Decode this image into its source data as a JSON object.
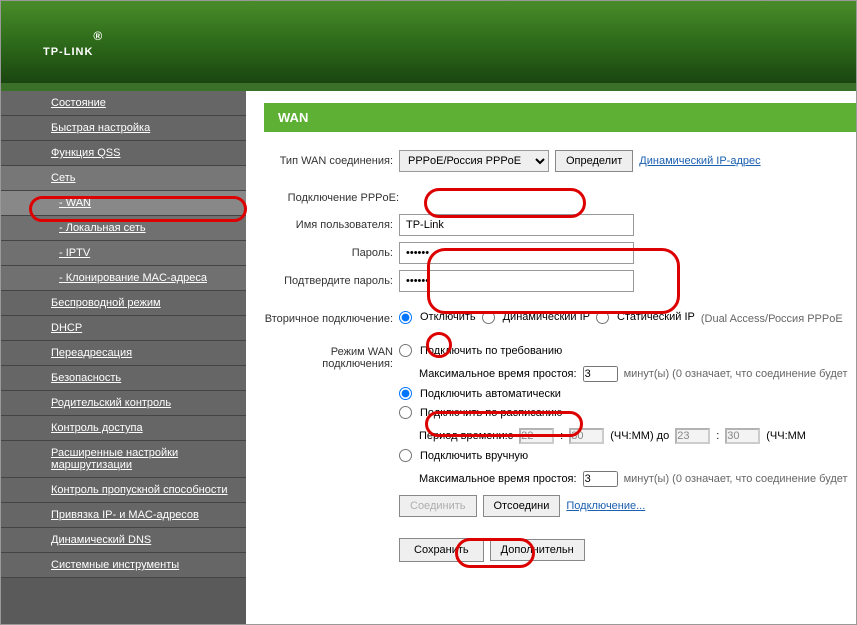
{
  "logo": "TP-LINK",
  "sidebar": {
    "items": [
      {
        "label": "Состояние",
        "sub": false
      },
      {
        "label": "Быстрая настройка",
        "sub": false
      },
      {
        "label": "Функция QSS",
        "sub": false
      },
      {
        "label": "Сеть",
        "sub": false,
        "activeParent": true
      },
      {
        "label": "- WAN",
        "sub": true,
        "active": true
      },
      {
        "label": "- Локальная сеть",
        "sub": true
      },
      {
        "label": "- IPTV",
        "sub": true
      },
      {
        "label": "- Клонирование MAC-адреса",
        "sub": true
      },
      {
        "label": "Беспроводной режим",
        "sub": false
      },
      {
        "label": "DHCP",
        "sub": false
      },
      {
        "label": "Переадресация",
        "sub": false
      },
      {
        "label": "Безопасность",
        "sub": false
      },
      {
        "label": "Родительский контроль",
        "sub": false
      },
      {
        "label": "Контроль доступа",
        "sub": false
      },
      {
        "label": "Расширенные настройки маршрутизации",
        "sub": false
      },
      {
        "label": "Контроль пропускной способности",
        "sub": false
      },
      {
        "label": "Привязка IP- и MAC-адресов",
        "sub": false
      },
      {
        "label": "Динамический DNS",
        "sub": false
      },
      {
        "label": "Системные инструменты",
        "sub": false
      }
    ]
  },
  "page": {
    "title": "WAN",
    "connType": {
      "label": "Тип WAN соединения:",
      "value": "PPPoE/Россия PPPoE",
      "detect": "Определит",
      "dynLink": "Динамический IP-адрес"
    },
    "pppoe": {
      "section": "Подключение PPPoE:",
      "user_label": "Имя пользователя:",
      "user": "TP-Link",
      "pass_label": "Пароль:",
      "pass": "••••••",
      "confirm_label": "Подтвердите пароль:",
      "confirm": "••••••"
    },
    "secondary": {
      "label": "Вторичное подключение:",
      "opts": [
        "Отключить",
        "Динамический IP",
        "Статический IP"
      ],
      "note": "(Dual Access/Россия PPPoE"
    },
    "wanMode": {
      "label": "Режим WAN подключения:",
      "onDemand": "Подключить по требованию",
      "idle_label": "Максимальное время простоя:",
      "idle": "3",
      "idle_unit": "минут(ы) (0 означает, что соединение будет",
      "auto": "Подключить автоматически",
      "schedule": "Подключить по расписанию",
      "period_label": "Период времени:с",
      "t1": "22",
      "t2": "30",
      "hhmm": "(ЧЧ:ММ) до",
      "t3": "23",
      "t4": "30",
      "hhmm2": "(ЧЧ:ММ",
      "manual": "Подключить вручную",
      "idle2_label": "Максимальное время простоя:",
      "idle2": "3",
      "idle2_unit": "минут(ы) (0 означает, что соединение будет",
      "connect": "Соединить",
      "disconnect": "Отсоедини",
      "connecting": "Подключение..."
    },
    "save": "Сохранить",
    "more": "Дополнительн"
  }
}
